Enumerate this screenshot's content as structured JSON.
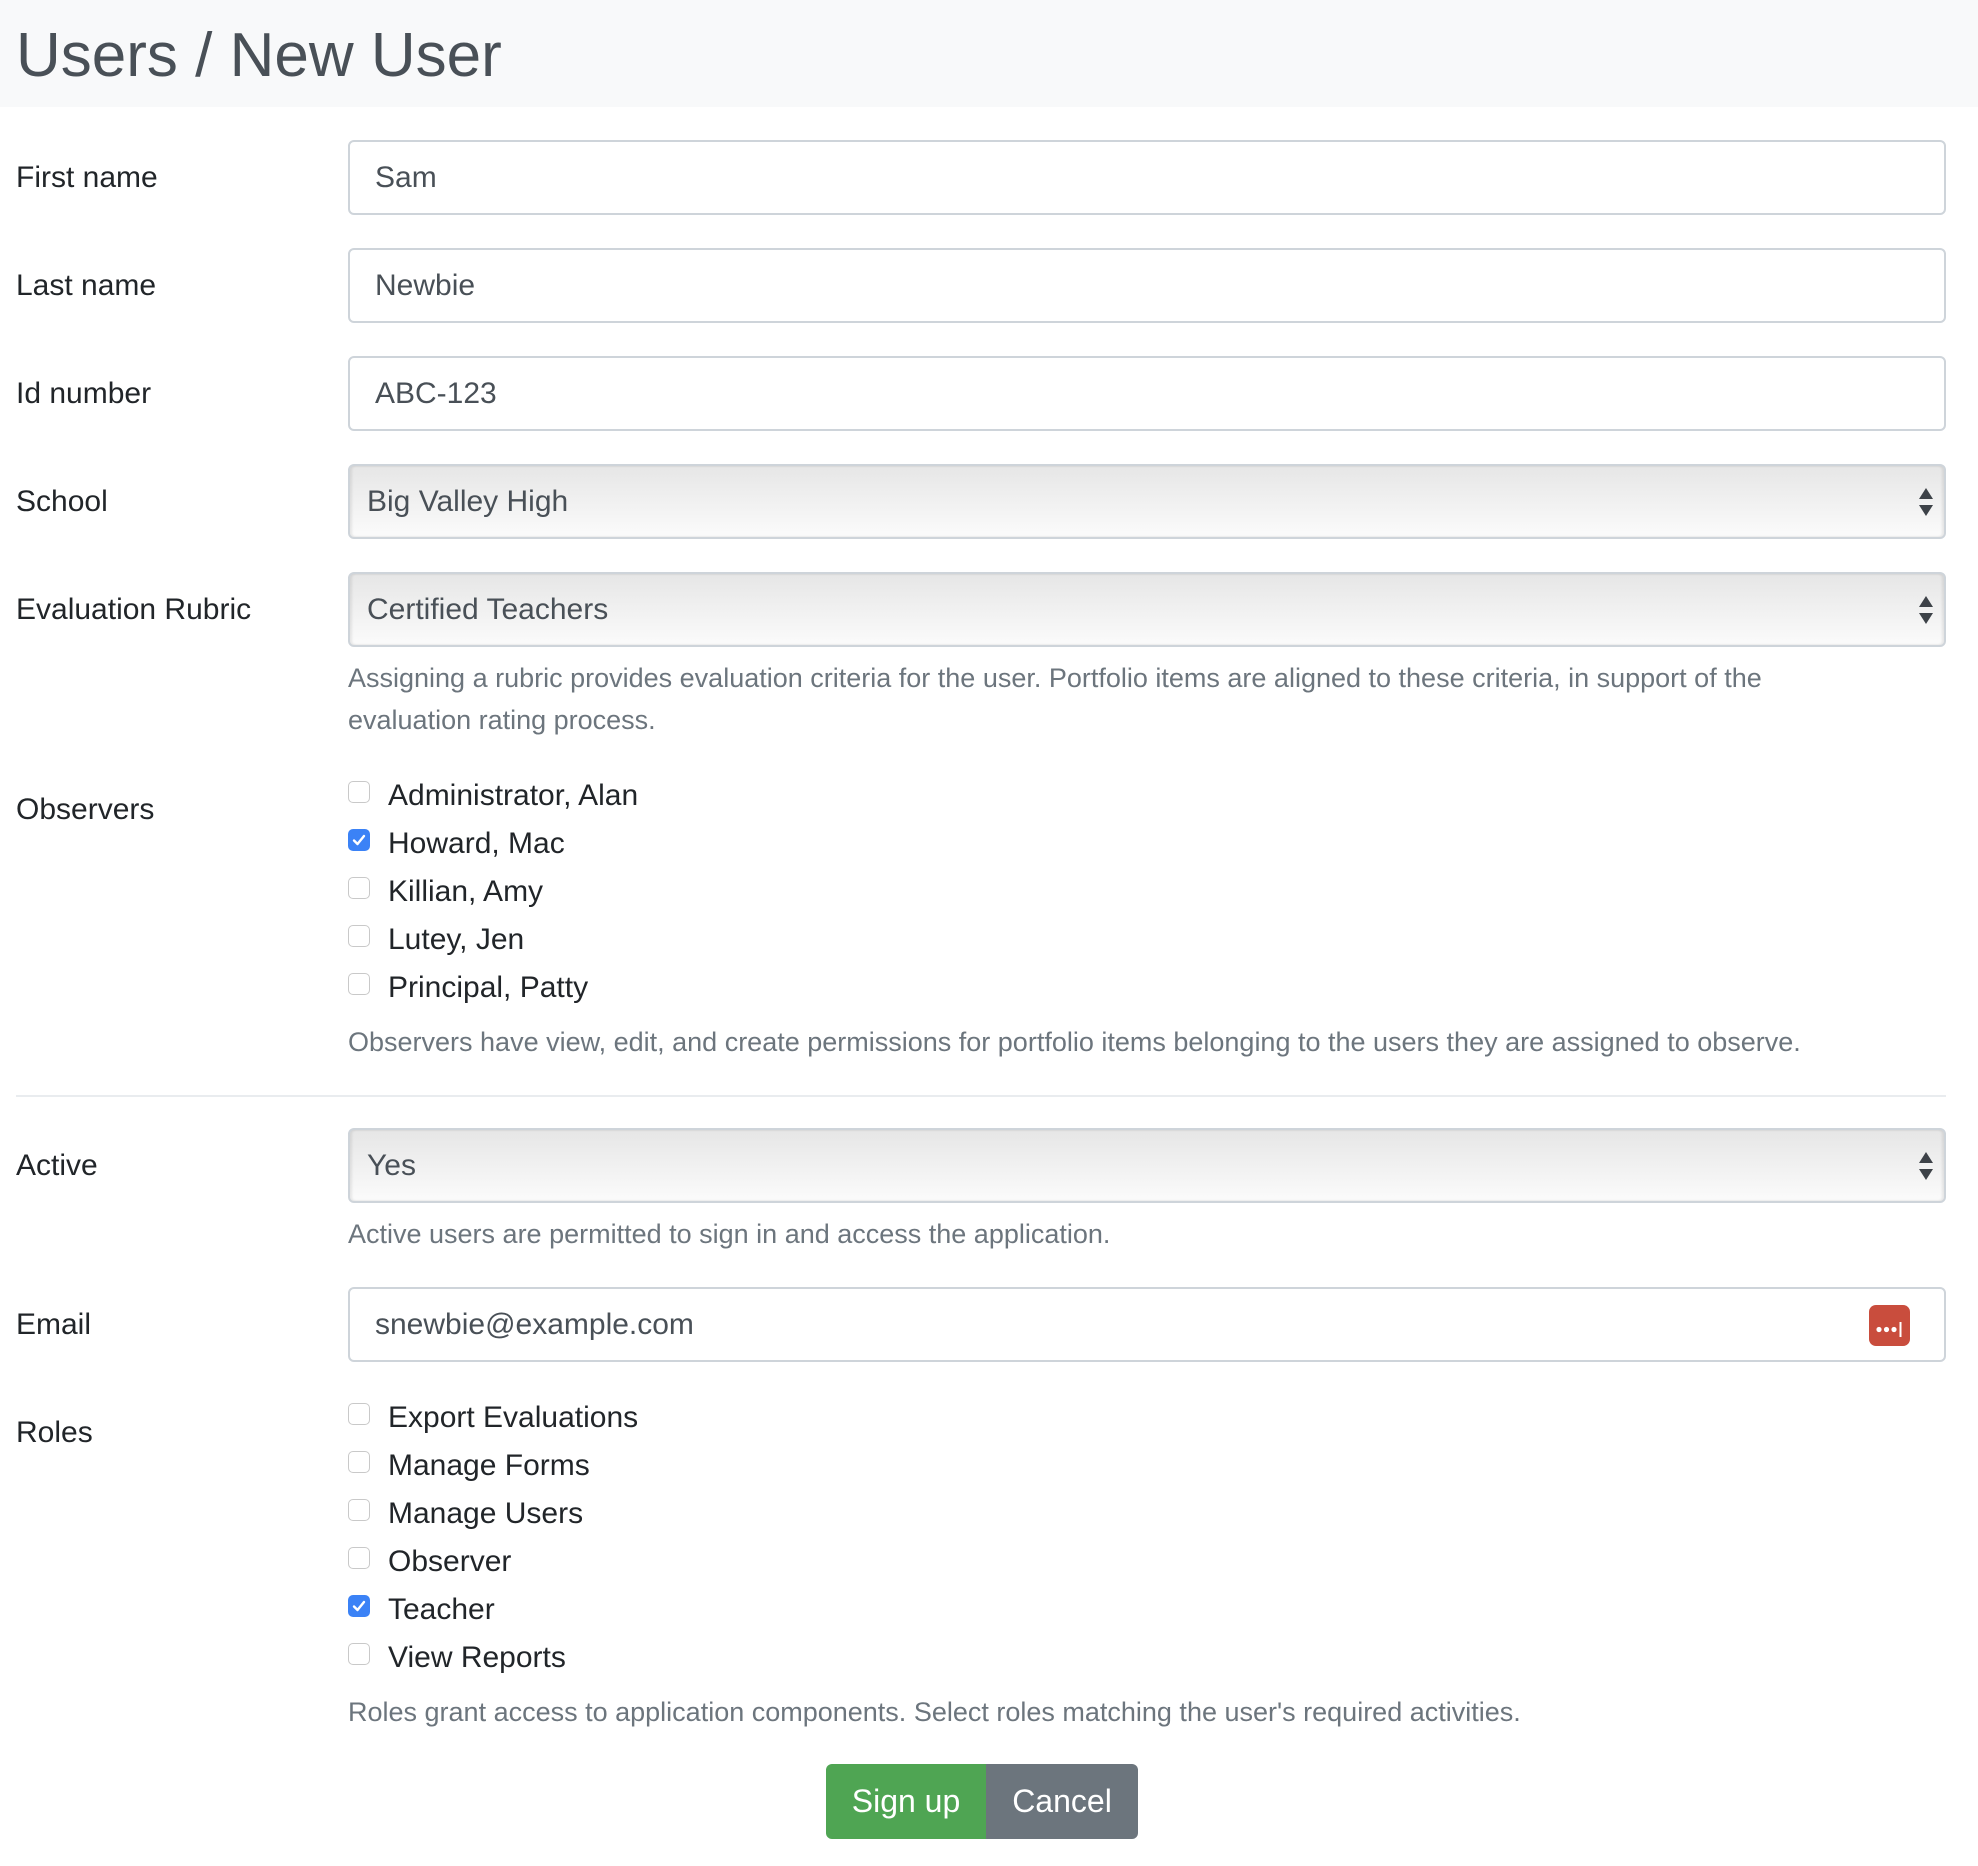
{
  "header": {
    "title": "Users / New User"
  },
  "form": {
    "first_name": {
      "label": "First name",
      "value": "Sam"
    },
    "last_name": {
      "label": "Last name",
      "value": "Newbie"
    },
    "id_number": {
      "label": "Id number",
      "value": "ABC-123"
    },
    "school": {
      "label": "School",
      "selected": "Big Valley High"
    },
    "evaluation_rubric": {
      "label": "Evaluation Rubric",
      "selected": "Certified Teachers",
      "hint_line1": "Assigning a rubric provides evaluation criteria for the user. Portfolio items are aligned to these criteria, in support of the",
      "hint_line2": "evaluation rating process."
    },
    "observers": {
      "label": "Observers",
      "items": [
        {
          "label": "Administrator, Alan",
          "checked": false
        },
        {
          "label": "Howard, Mac",
          "checked": true
        },
        {
          "label": "Killian, Amy",
          "checked": false
        },
        {
          "label": "Lutey, Jen",
          "checked": false
        },
        {
          "label": "Principal, Patty",
          "checked": false
        }
      ],
      "hint": "Observers have view, edit, and create permissions for portfolio items belonging to the users they are assigned to observe."
    },
    "active": {
      "label": "Active",
      "selected": "Yes",
      "hint": "Active users are permitted to sign in and access the application."
    },
    "email": {
      "label": "Email",
      "value": "snewbie@example.com",
      "icon": "password-manager-icon"
    },
    "roles": {
      "label": "Roles",
      "items": [
        {
          "label": "Export Evaluations",
          "checked": false
        },
        {
          "label": "Manage Forms",
          "checked": false
        },
        {
          "label": "Manage Users",
          "checked": false
        },
        {
          "label": "Observer",
          "checked": false
        },
        {
          "label": "Teacher",
          "checked": true
        },
        {
          "label": "View Reports",
          "checked": false
        }
      ],
      "hint": "Roles grant access to application components. Select roles matching the user's required activities."
    }
  },
  "buttons": {
    "signup": "Sign up",
    "cancel": "Cancel"
  },
  "colors": {
    "signup": "#4fa553",
    "cancel": "#6c757d",
    "checkbox_checked": "#3b82f6",
    "password_icon": "#c94d3d"
  }
}
